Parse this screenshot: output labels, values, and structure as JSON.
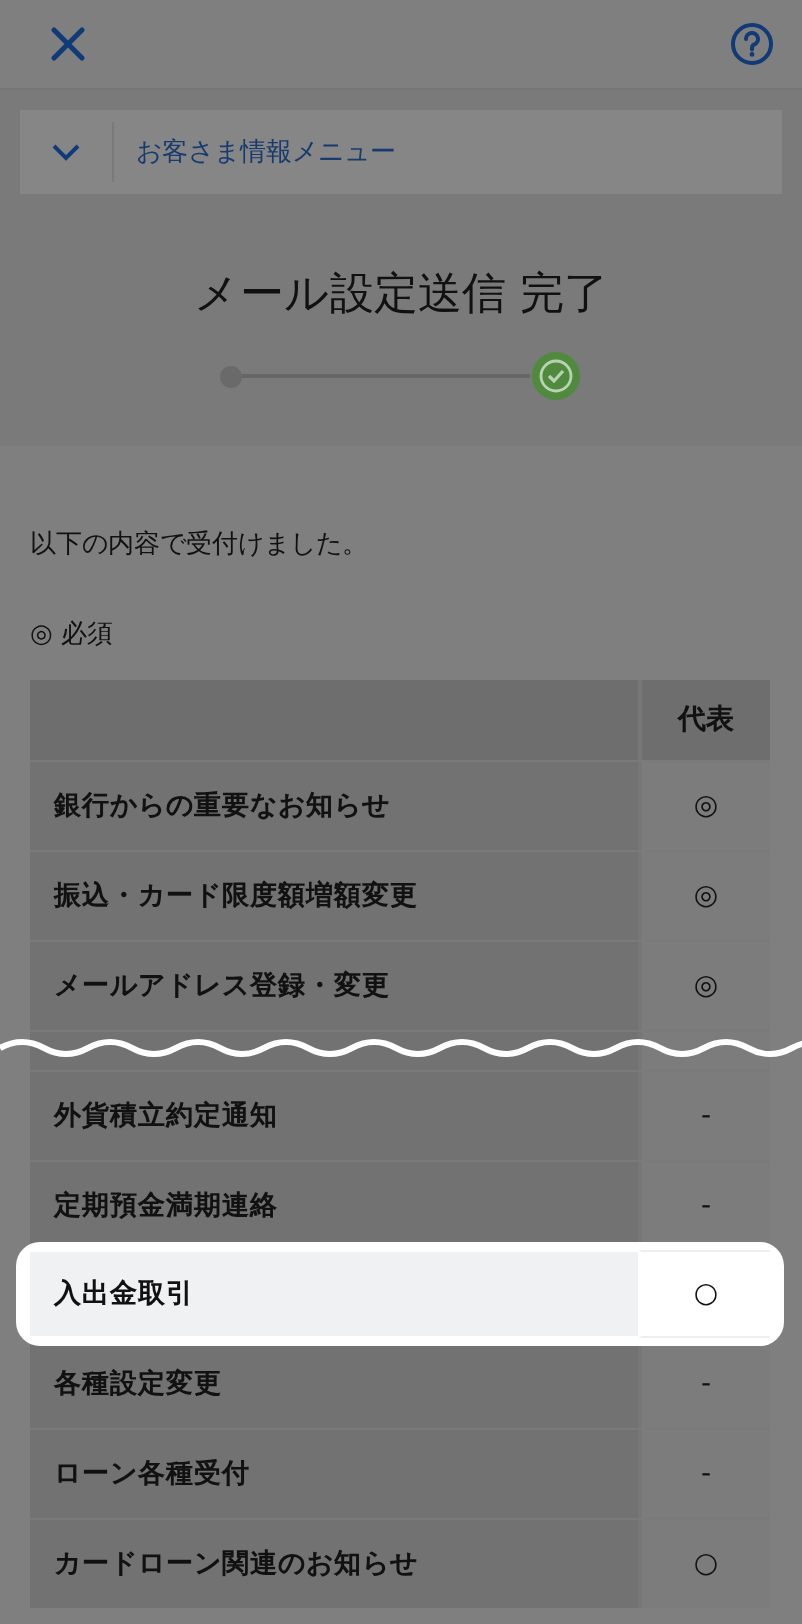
{
  "menu": {
    "label": "お客さま情報メニュー",
    "expanded": false
  },
  "title": "メール設定送信 完了",
  "steps": [
    {
      "selected": false
    },
    {
      "selected": true
    }
  ],
  "message": "以下の内容で受付けました。",
  "legend": "◎ 必須",
  "table": {
    "columns": [
      "代表"
    ],
    "rows_before_break": [
      {
        "label": "銀行からの重要なお知らせ",
        "value": "◎",
        "highlighted": false
      },
      {
        "label": "振込・カード限度額増額変更",
        "value": "◎",
        "highlighted": false
      },
      {
        "label": "メールアドレス登録・変更",
        "value": "◎",
        "highlighted": false
      }
    ],
    "rows_after_break": [
      {
        "label": "外貨積立約定通知",
        "value": "-",
        "highlighted": false
      },
      {
        "label": "定期預金満期連絡",
        "value": "-",
        "highlighted": false
      },
      {
        "label": "入出金取引",
        "value": "○",
        "highlighted": true
      },
      {
        "label": "各種設定変更",
        "value": "-",
        "highlighted": false
      },
      {
        "label": "ローン各種受付",
        "value": "-",
        "highlighted": false
      },
      {
        "label": "カードローン関連のお知らせ",
        "value": "○",
        "highlighted": false
      }
    ]
  }
}
